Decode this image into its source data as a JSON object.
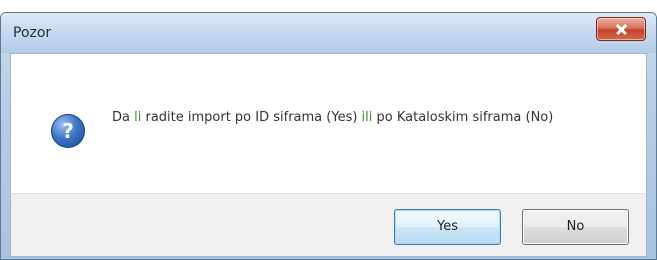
{
  "dialog": {
    "title": "Pozor",
    "icon": "question-icon",
    "icon_glyph": "?",
    "message_parts": [
      "Da ",
      "li",
      " radite import po ID siframa (Yes) ",
      "ili",
      " po Kataloskim siframa (No)"
    ],
    "buttons": {
      "yes": "Yes",
      "no": "No"
    }
  }
}
